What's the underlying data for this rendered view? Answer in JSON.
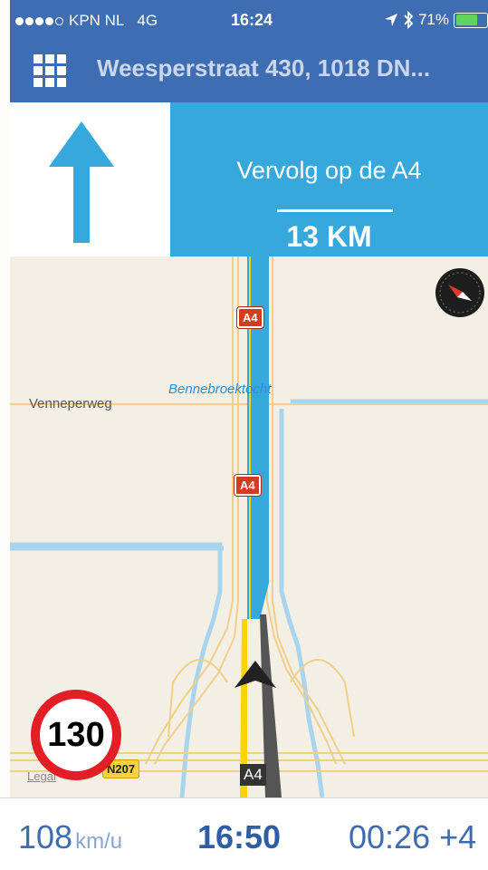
{
  "status_bar": {
    "carrier": "KPN NL",
    "network": "4G",
    "time": "16:24",
    "battery": "71%",
    "battery_level": 0.71
  },
  "header": {
    "destination": "Weesperstraat 430, 1018 DN..."
  },
  "instruction": {
    "text": "Vervolg op de A4",
    "distance": "13 KM"
  },
  "map": {
    "road_labels": [
      "Venneperweg"
    ],
    "water_labels": [
      "Bennebroektocht"
    ],
    "shields": [
      "A4",
      "A4",
      "N207",
      "A4"
    ],
    "legal": "Legal",
    "speed_limit": "130"
  },
  "bottom": {
    "speed_value": "108",
    "speed_unit": "km/u",
    "arrival_time": "16:50",
    "remaining": "00:26 +4"
  },
  "colors": {
    "header_bg": "#3e6db2",
    "instruction_bg": "#36a8dc",
    "route": "#36a8dc",
    "speed_ring": "#e31e25"
  }
}
